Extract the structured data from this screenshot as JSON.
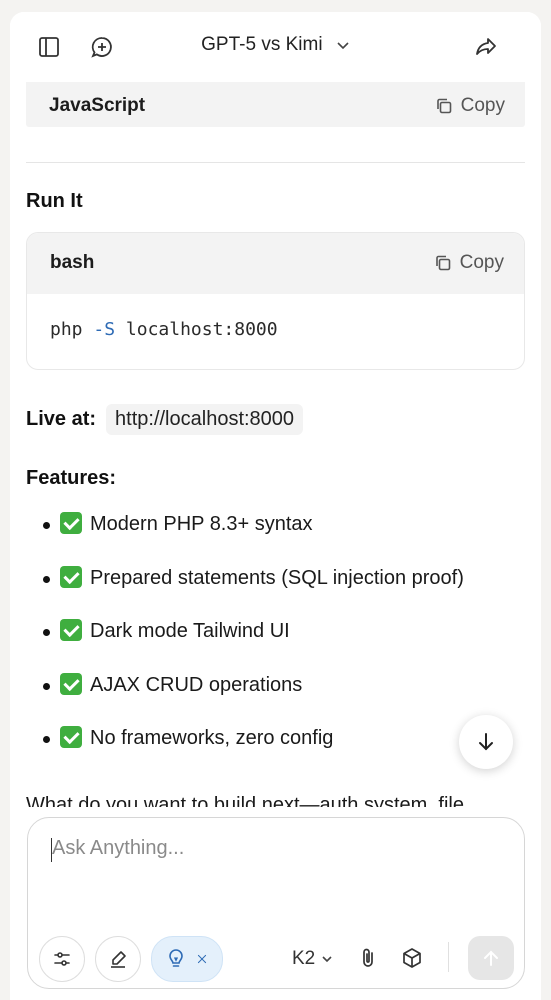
{
  "header": {
    "title": "GPT-5 vs Kimi"
  },
  "code_block_top": {
    "language": "JavaScript",
    "copy_label": "Copy"
  },
  "section_run": {
    "heading": "Run It",
    "code_block": {
      "language": "bash",
      "copy_label": "Copy",
      "command": "php",
      "flag": "-S",
      "argument": "localhost:8000"
    }
  },
  "live": {
    "label": "Live at:",
    "url": "http://localhost:8000"
  },
  "features": {
    "heading": "Features:",
    "items": [
      "Modern PHP 8.3+ syntax",
      "Prepared statements (SQL injection proof)",
      "Dark mode Tailwind UI",
      "AJAX CRUD operations",
      "No frameworks, zero config"
    ]
  },
  "partial_text": "What do you want to build next—auth system, file",
  "composer": {
    "placeholder": "Ask Anything...",
    "model_label": "K2"
  },
  "colors": {
    "accent_blue": "#2e6bb5",
    "check_green": "#3fae3f",
    "active_tool_bg": "#e4f0fb"
  },
  "icons": {
    "sidebar": "sidebar-toggle-icon",
    "new_chat": "new-chat-icon",
    "share": "share-icon",
    "copy": "copy-icon",
    "scroll_down": "arrow-down-icon",
    "settings": "sliders-icon",
    "edit": "pen-icon",
    "think": "lightbulb-icon",
    "attach": "paperclip-icon",
    "cube": "cube-icon",
    "send": "arrow-up-icon"
  }
}
